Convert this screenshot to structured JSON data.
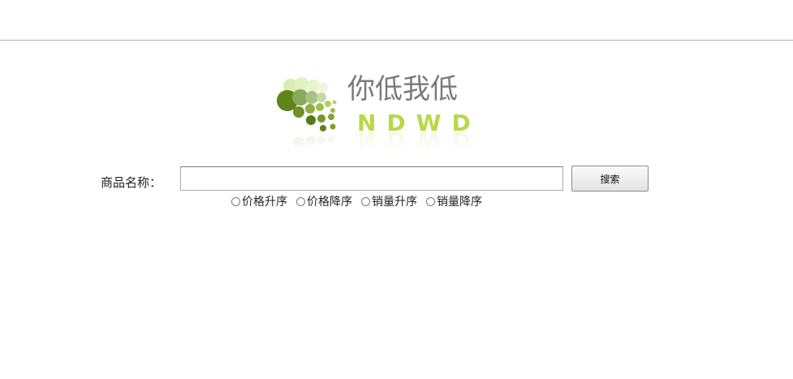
{
  "logo": {
    "chinese_text": "你低我低",
    "latin_text": "NDWD",
    "colors": {
      "dark_green": "#5a7e16",
      "mid_green": "#8cb43a",
      "light_green": "#c4e062",
      "text_gray": "#7a7a7a"
    }
  },
  "search": {
    "label": "商品名称：",
    "value": "",
    "button_label": "搜索"
  },
  "sort_options": [
    {
      "label": "价格升序",
      "checked": false
    },
    {
      "label": "价格降序",
      "checked": false
    },
    {
      "label": "销量升序",
      "checked": false
    },
    {
      "label": "销量降序",
      "checked": false
    }
  ]
}
